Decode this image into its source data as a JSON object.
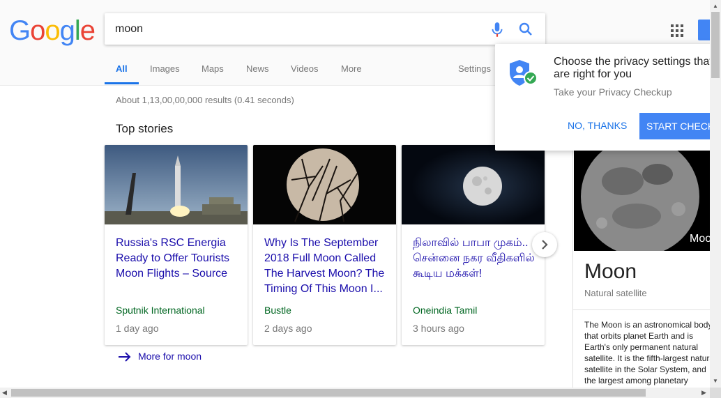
{
  "logo": {
    "letters": [
      "G",
      "o",
      "o",
      "g",
      "l",
      "e"
    ]
  },
  "search": {
    "query": "moon"
  },
  "tabs": [
    {
      "label": "All"
    },
    {
      "label": "Images"
    },
    {
      "label": "Maps"
    },
    {
      "label": "News"
    },
    {
      "label": "Videos"
    },
    {
      "label": "More"
    },
    {
      "label": "Settings"
    }
  ],
  "result_stats": "About 1,13,00,00,000 results (0.41 seconds)",
  "top_stories": {
    "title": "Top stories",
    "cards": [
      {
        "headline": "Russia's RSC Energia Ready to Offer Tourists Moon Flights – Source",
        "source": "Sputnik International",
        "time": "1 day ago"
      },
      {
        "headline": "Why Is The September 2018 Full Moon Called The Harvest Moon? The Timing Of This Moon I...",
        "source": "Bustle",
        "time": "2 days ago"
      },
      {
        "headline": "நிலாவில் பாபா முகம்.. சென்னை நகர வீதிகளில் கூடிய மக்கள்!",
        "source": "Oneindia Tamil",
        "time": "3 hours ago"
      }
    ],
    "more_link": "More for moon"
  },
  "privacy_popup": {
    "title": "Choose the privacy settings that are right for you",
    "subtitle": "Take your Privacy Checkup",
    "no_thanks": "NO, THANKS",
    "start": "START CHECKUP"
  },
  "knowledge_panel": {
    "image_label": "Moon",
    "title": "Moon",
    "subtitle": "Natural satellite",
    "description": "The Moon is an astronomical body that orbits planet Earth and is Earth's only permanent natural satellite. It is the fifth-largest natural satellite in the Solar System, and the largest among planetary satellites relative to the size of the planet"
  },
  "colors": {
    "link": "#1a0dab",
    "accent": "#1a73e8",
    "source_green": "#006621",
    "button_blue": "#4285f4"
  },
  "icons": [
    "mic-icon",
    "search-icon",
    "apps-grid-icon",
    "privacy-shield-icon",
    "chevron-right-icon",
    "arrow-right-icon"
  ]
}
